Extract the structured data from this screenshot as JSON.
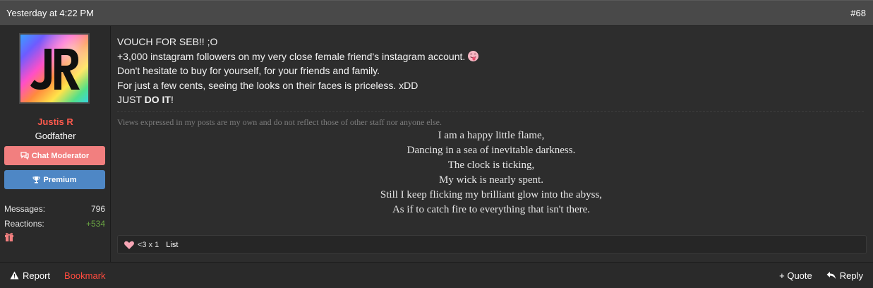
{
  "header": {
    "timestamp": "Yesterday at 4:22 PM",
    "post_number": "#68"
  },
  "user": {
    "name": "Justis R",
    "title": "Godfather",
    "badges": [
      {
        "label": "Chat Moderator",
        "icon": "chat-bubbles-icon"
      },
      {
        "label": "Premium",
        "icon": "trophy-icon"
      }
    ],
    "stats": {
      "messages_label": "Messages:",
      "messages_value": "796",
      "reactions_label": "Reactions:",
      "reactions_value": "+534"
    },
    "gift_icon": "gift-icon"
  },
  "post": {
    "lines": [
      "VOUCH FOR SEB!! ;O",
      "+3,000 instagram followers on my very close female friend's instagram account.",
      "Don't hesitate to buy for yourself, for your friends and family.",
      "For just a few cents, seeing the looks on their faces is priceless. xDD"
    ],
    "last_line_prefix": "JUST ",
    "last_line_bold": "DO IT",
    "last_line_suffix": "!",
    "emoji": "tongue-face-emoji"
  },
  "signature": {
    "note": "Views expressed in my posts are my own and do not reflect those of other staff nor anyone else.",
    "poem": [
      "I am a happy little flame,",
      "Dancing in a sea of inevitable darkness.",
      "The clock is ticking,",
      "My wick is nearly spent.",
      "Still I keep flicking my brilliant glow into the abyss,",
      "As if to catch fire to everything that isn't there."
    ]
  },
  "reactions": {
    "summary": "<3 x 1",
    "list_label": "List",
    "icon": "heart-reaction-icon"
  },
  "footer": {
    "report_label": "Report",
    "bookmark_label": "Bookmark",
    "quote_label": "+ Quote",
    "reply_label": "Reply"
  },
  "colors": {
    "username": "#ff5a4d",
    "chat_badge": "#f27f7f",
    "premium_badge": "#4e87c5",
    "reactions_value": "#6aa543",
    "bookmark": "#ff4b3e"
  }
}
